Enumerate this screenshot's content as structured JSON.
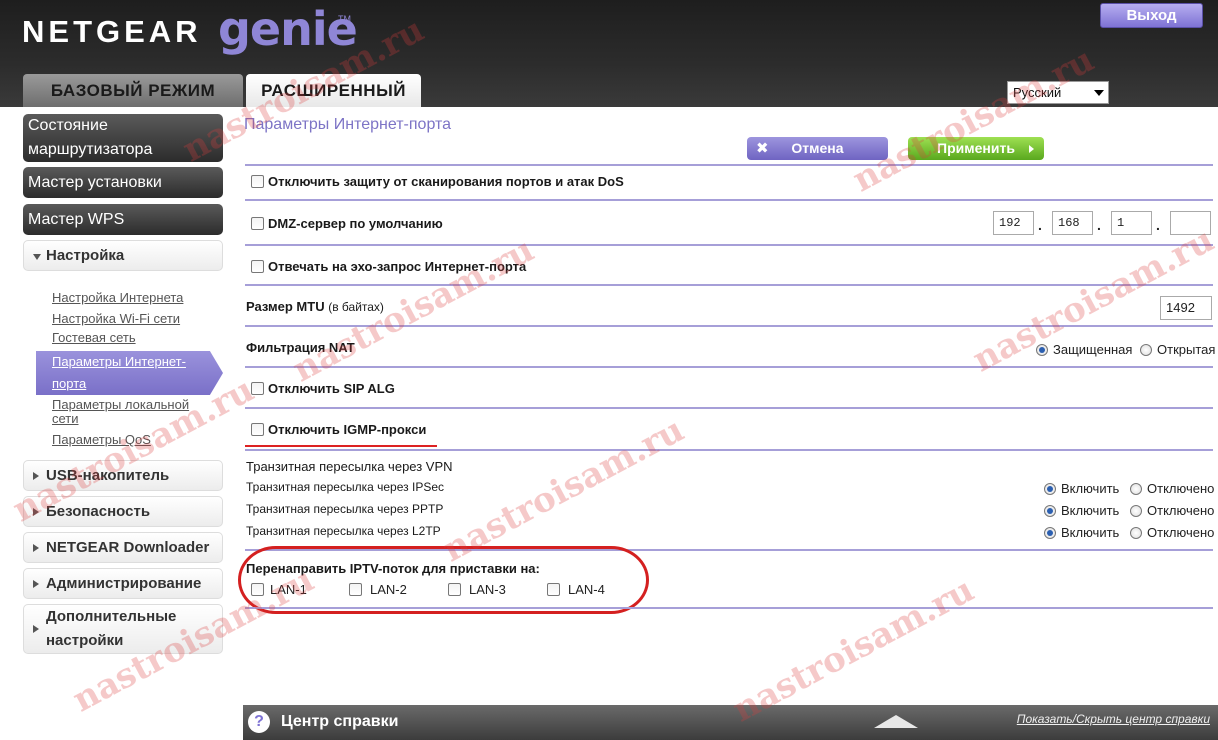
{
  "header": {
    "brand": "NETGEAR",
    "product": "genie",
    "tm": "TM",
    "logout_label": "Выход"
  },
  "tabs": {
    "basic": "БАЗОВЫЙ РЕЖИМ",
    "advanced": "РАСШИРЕННЫЙ"
  },
  "language": {
    "selected": "Русский"
  },
  "sidebar": {
    "router_status_line1": "Состояние",
    "router_status_line2": "маршрутизатора",
    "setup_wizard": "Мастер установки",
    "wps_wizard": "Мастер WPS",
    "setup": "Настройка",
    "sub_items": {
      "internet": "Настройка Интернета",
      "wifi": "Настройка Wi-Fi сети",
      "guest": "Гостевая сеть",
      "wan_line1": "Параметры Интернет-",
      "wan_line2": "порта",
      "lan_line1": "Параметры локальной",
      "lan_line2": "сети",
      "qos": "Параметры QoS"
    },
    "usb": "USB-накопитель",
    "security": "Безопасность",
    "downloader": "NETGEAR Downloader",
    "admin": "Администрирование",
    "advanced_line1": "Дополнительные",
    "advanced_line2": "настройки"
  },
  "content": {
    "title": "Параметры Интернет-порта",
    "cancel_label": "Отмена",
    "apply_label": "Применить",
    "disable_dos": "Отключить защиту от сканирования портов и атак DoS",
    "dmz": "DMZ-сервер по умолчанию",
    "dmz_ip": {
      "o1": "192",
      "o2": "168",
      "o3": "1",
      "o4": ""
    },
    "ping": "Отвечать на эхо-запрос Интернет-порта",
    "mtu_label": "Размер MTU",
    "mtu_unit": "(в байтах)",
    "mtu_value": "1492",
    "nat_label": "Фильтрация NAT",
    "nat_secured": "Защищенная",
    "nat_open": "Открытая",
    "sip_alg": "Отключить SIP ALG",
    "igmp": "Отключить IGMP-прокси",
    "vpn_heading": "Транзитная пересылка через VPN",
    "vpn_ipsec": "Транзитная пересылка через IPSec",
    "vpn_pptp": "Транзитная пересылка через PPTP",
    "vpn_l2tp": "Транзитная пересылка через L2TP",
    "enable": "Включить",
    "disable": "Отключено",
    "iptv_heading": "Перенаправить IPTV-поток для приставки на:",
    "lan1": "LAN-1",
    "lan2": "LAN-2",
    "lan3": "LAN-3",
    "lan4": "LAN-4"
  },
  "help": {
    "title": "Центр справки",
    "toggle": "Показать/Скрыть центр справки",
    "icon": "?"
  },
  "watermark": "nastroisam.ru"
}
